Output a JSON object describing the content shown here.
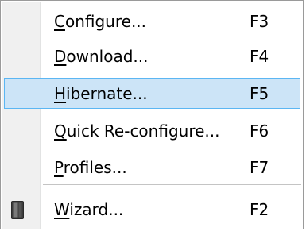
{
  "menu": {
    "items": [
      {
        "label": "Configure...",
        "mnemonic": "C",
        "rest": "onfigure...",
        "shortcut": "F3",
        "highlighted": false
      },
      {
        "label": "Download...",
        "mnemonic": "D",
        "rest": "ownload...",
        "shortcut": "F4",
        "highlighted": false
      },
      {
        "label": "Hibernate...",
        "mnemonic": "H",
        "rest": "ibernate...",
        "shortcut": "F5",
        "highlighted": true
      },
      {
        "label": "Quick Re-configure...",
        "mnemonic": "Q",
        "rest": "uick Re-configure...",
        "shortcut": "F6",
        "highlighted": false
      },
      {
        "label": "Profiles...",
        "mnemonic": "P",
        "rest": "rofiles...",
        "shortcut": "F7",
        "highlighted": false
      },
      {
        "label": "Wizard...",
        "mnemonic": "W",
        "rest": "izard...",
        "shortcut": "F2",
        "highlighted": false,
        "icon": "wizard-icon"
      }
    ]
  },
  "colors": {
    "highlight_fill": "#cce4f7",
    "highlight_border": "#5bb6f3",
    "icon_column": "#f0f0f0",
    "menu_border": "#9a9a9a",
    "separator": "#c4c4c4"
  }
}
